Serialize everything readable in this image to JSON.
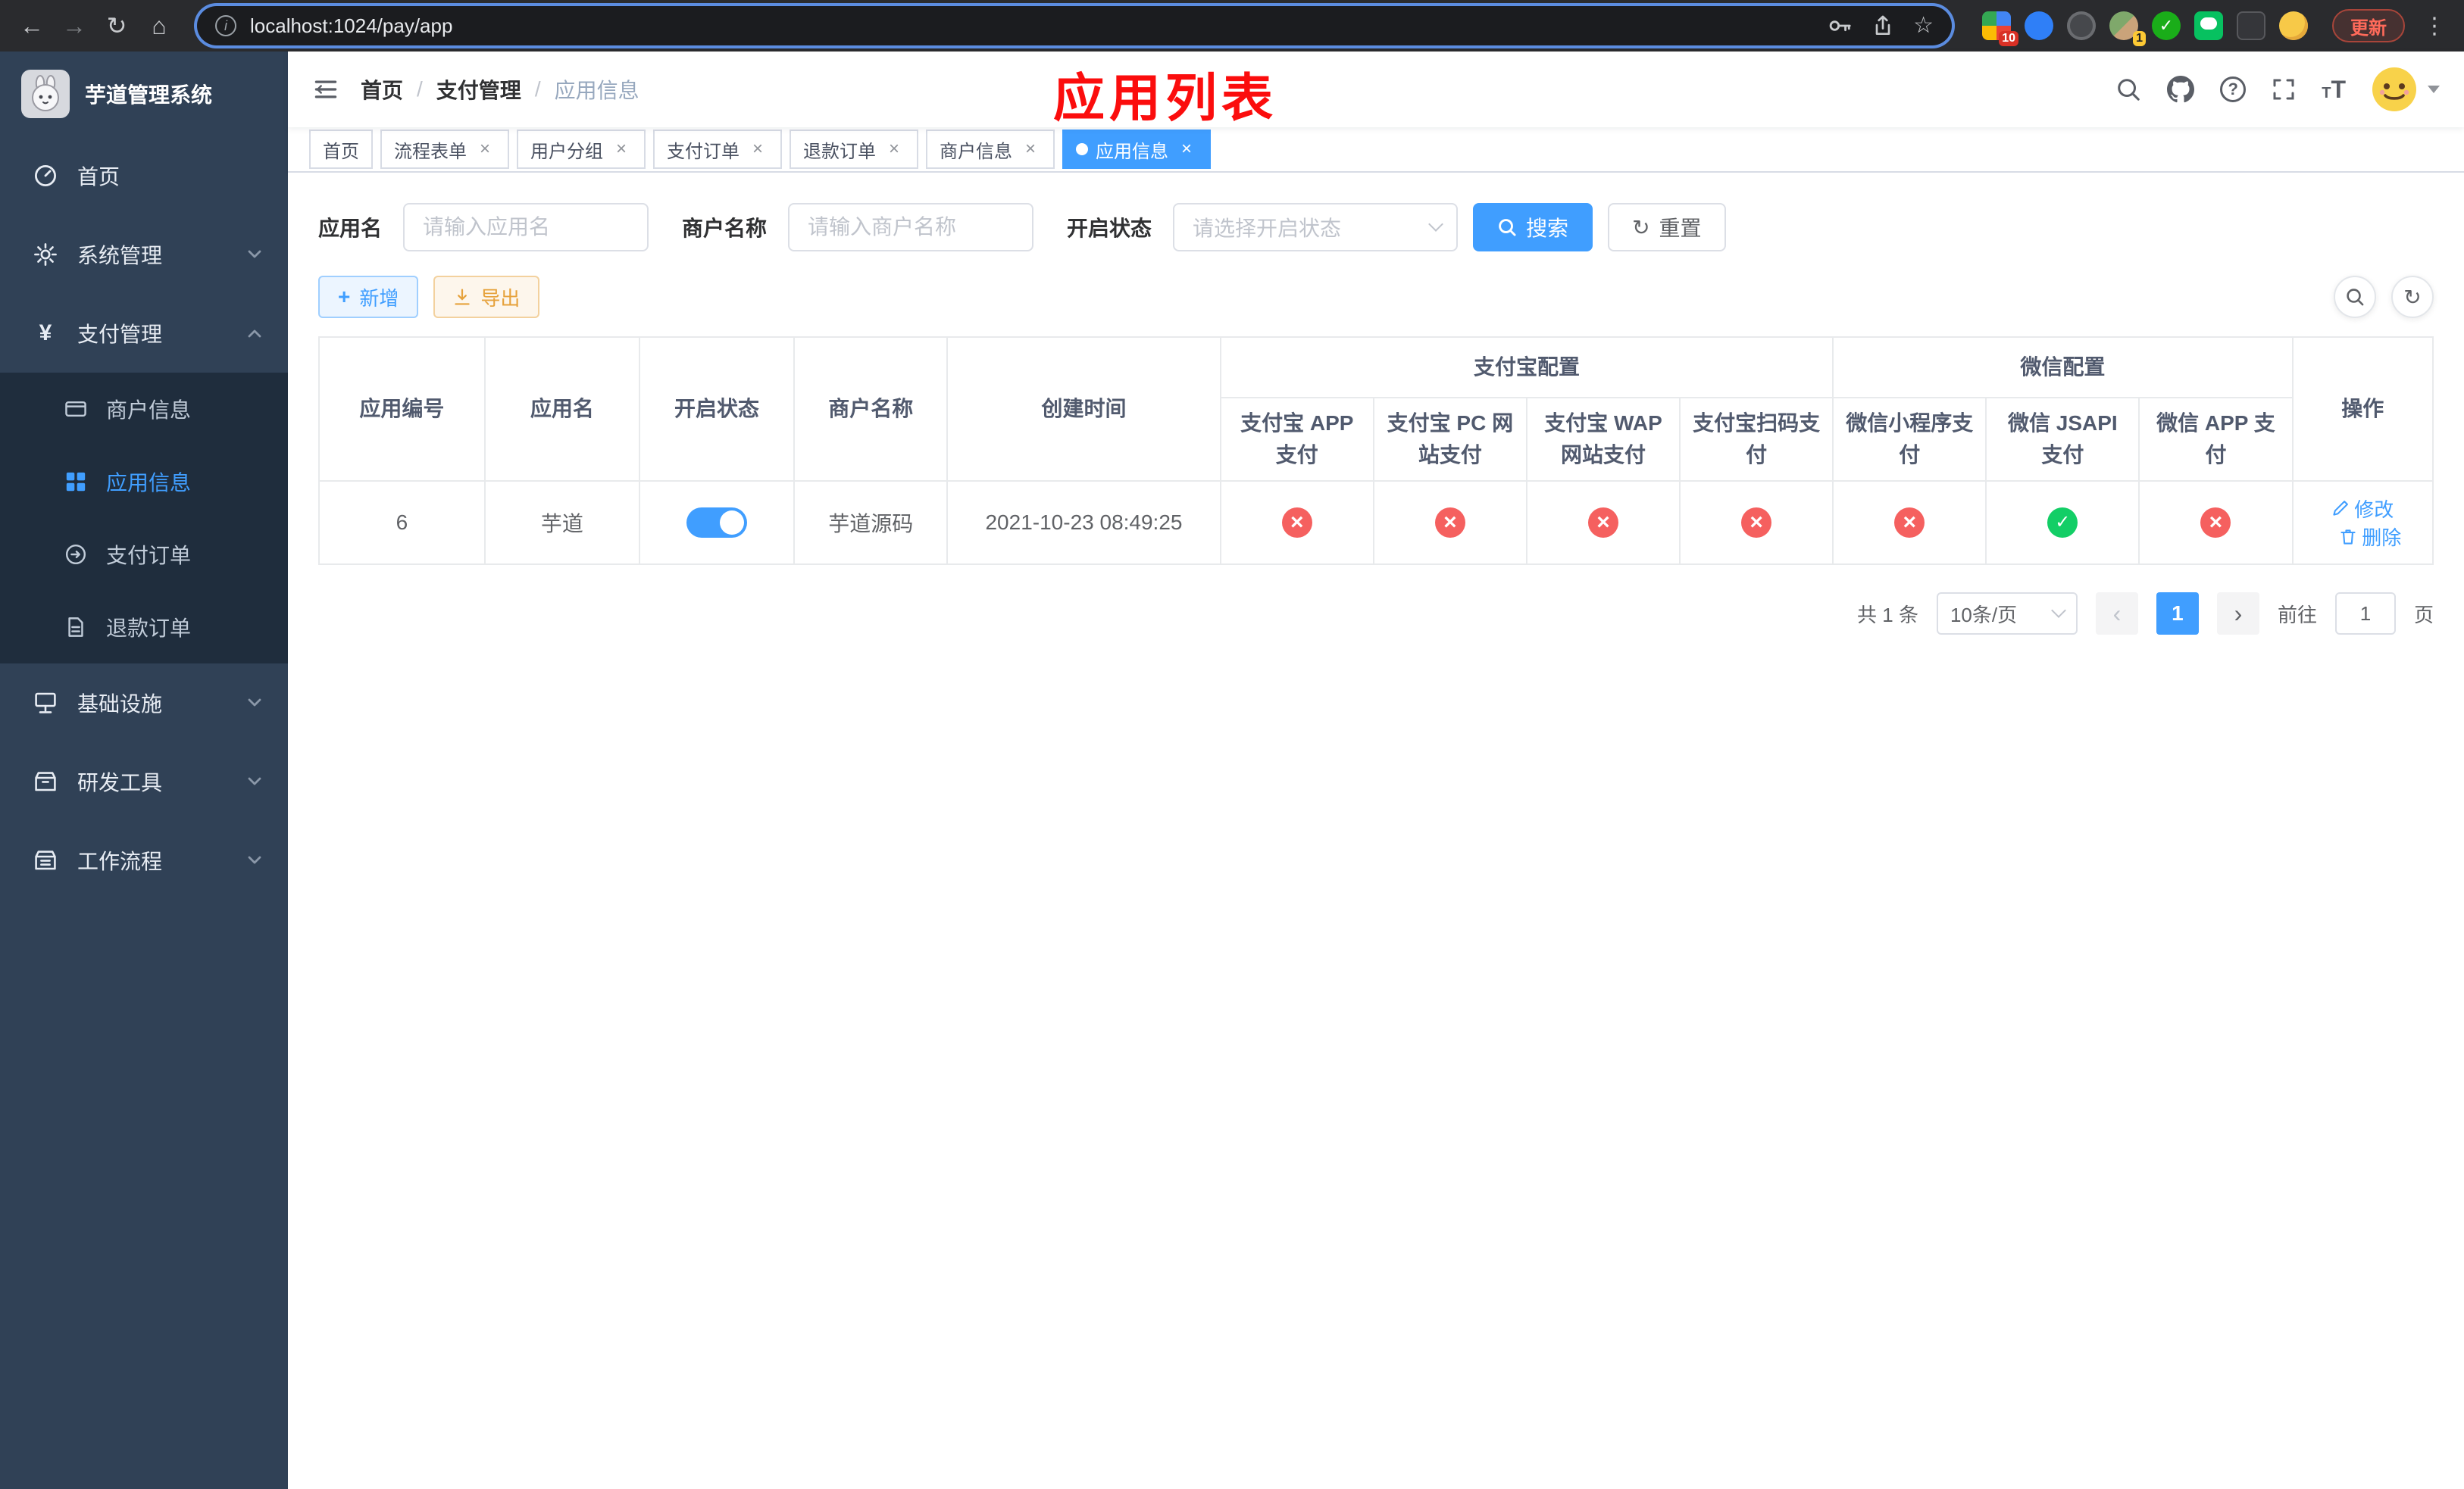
{
  "browser": {
    "url": "localhost:1024/pay/app",
    "update_label": "更新",
    "extension_badge": "10",
    "avatar_badge": "1"
  },
  "app": {
    "title": "芋道管理系统"
  },
  "sidebar": {
    "items": [
      {
        "label": "首页"
      },
      {
        "label": "系统管理"
      },
      {
        "label": "支付管理"
      },
      {
        "label": "基础设施"
      },
      {
        "label": "研发工具"
      },
      {
        "label": "工作流程"
      }
    ],
    "payment_submenu": [
      {
        "label": "商户信息"
      },
      {
        "label": "应用信息"
      },
      {
        "label": "支付订单"
      },
      {
        "label": "退款订单"
      }
    ]
  },
  "breadcrumb": {
    "items": [
      "首页",
      "支付管理",
      "应用信息"
    ],
    "separator": "/"
  },
  "annotation": "应用列表",
  "tabs": [
    {
      "label": "首页",
      "closable": false,
      "active": false
    },
    {
      "label": "流程表单",
      "closable": true,
      "active": false
    },
    {
      "label": "用户分组",
      "closable": true,
      "active": false
    },
    {
      "label": "支付订单",
      "closable": true,
      "active": false
    },
    {
      "label": "退款订单",
      "closable": true,
      "active": false
    },
    {
      "label": "商户信息",
      "closable": true,
      "active": false
    },
    {
      "label": "应用信息",
      "closable": true,
      "active": true
    }
  ],
  "filters": {
    "app_name_label": "应用名",
    "app_name_placeholder": "请输入应用名",
    "merchant_label": "商户名称",
    "merchant_placeholder": "请输入商户名称",
    "status_label": "开启状态",
    "status_placeholder": "请选择开启状态",
    "search_label": "搜索",
    "reset_label": "重置"
  },
  "toolbar": {
    "add_label": "新增",
    "export_label": "导出"
  },
  "table": {
    "headers": {
      "app_id": "应用编号",
      "app_name": "应用名",
      "status": "开启状态",
      "merchant": "商户名称",
      "created": "创建时间",
      "alipay_group": "支付宝配置",
      "wechat_group": "微信配置",
      "actions": "操作",
      "alipay_cols": [
        "支付宝 APP 支付",
        "支付宝 PC 网站支付",
        "支付宝 WAP 网站支付",
        "支付宝扫码支付"
      ],
      "wechat_cols": [
        "微信小程序支付",
        "微信 JSAPI 支付",
        "微信 APP 支付"
      ]
    },
    "rows": [
      {
        "app_id": "6",
        "app_name": "芋道",
        "status": "on",
        "merchant": "芋道源码",
        "created": "2021-10-23 08:49:25",
        "channels": [
          "cross",
          "cross",
          "cross",
          "cross",
          "cross",
          "check",
          "cross"
        ],
        "edit_label": "修改",
        "delete_label": "删除"
      }
    ]
  },
  "pagination": {
    "total": "共 1 条",
    "page_size": "10条/页",
    "current_page": "1",
    "goto_label": "前往",
    "goto_value": "1",
    "page_label": "页"
  },
  "colors": {
    "primary": "#409eff",
    "success": "#13ce66",
    "danger": "#f56c6c",
    "warning": "#e6a23c",
    "annotation": "#fb0d0d",
    "sidebar_bg": "#304156",
    "submenu_bg": "#1f2d3d"
  }
}
